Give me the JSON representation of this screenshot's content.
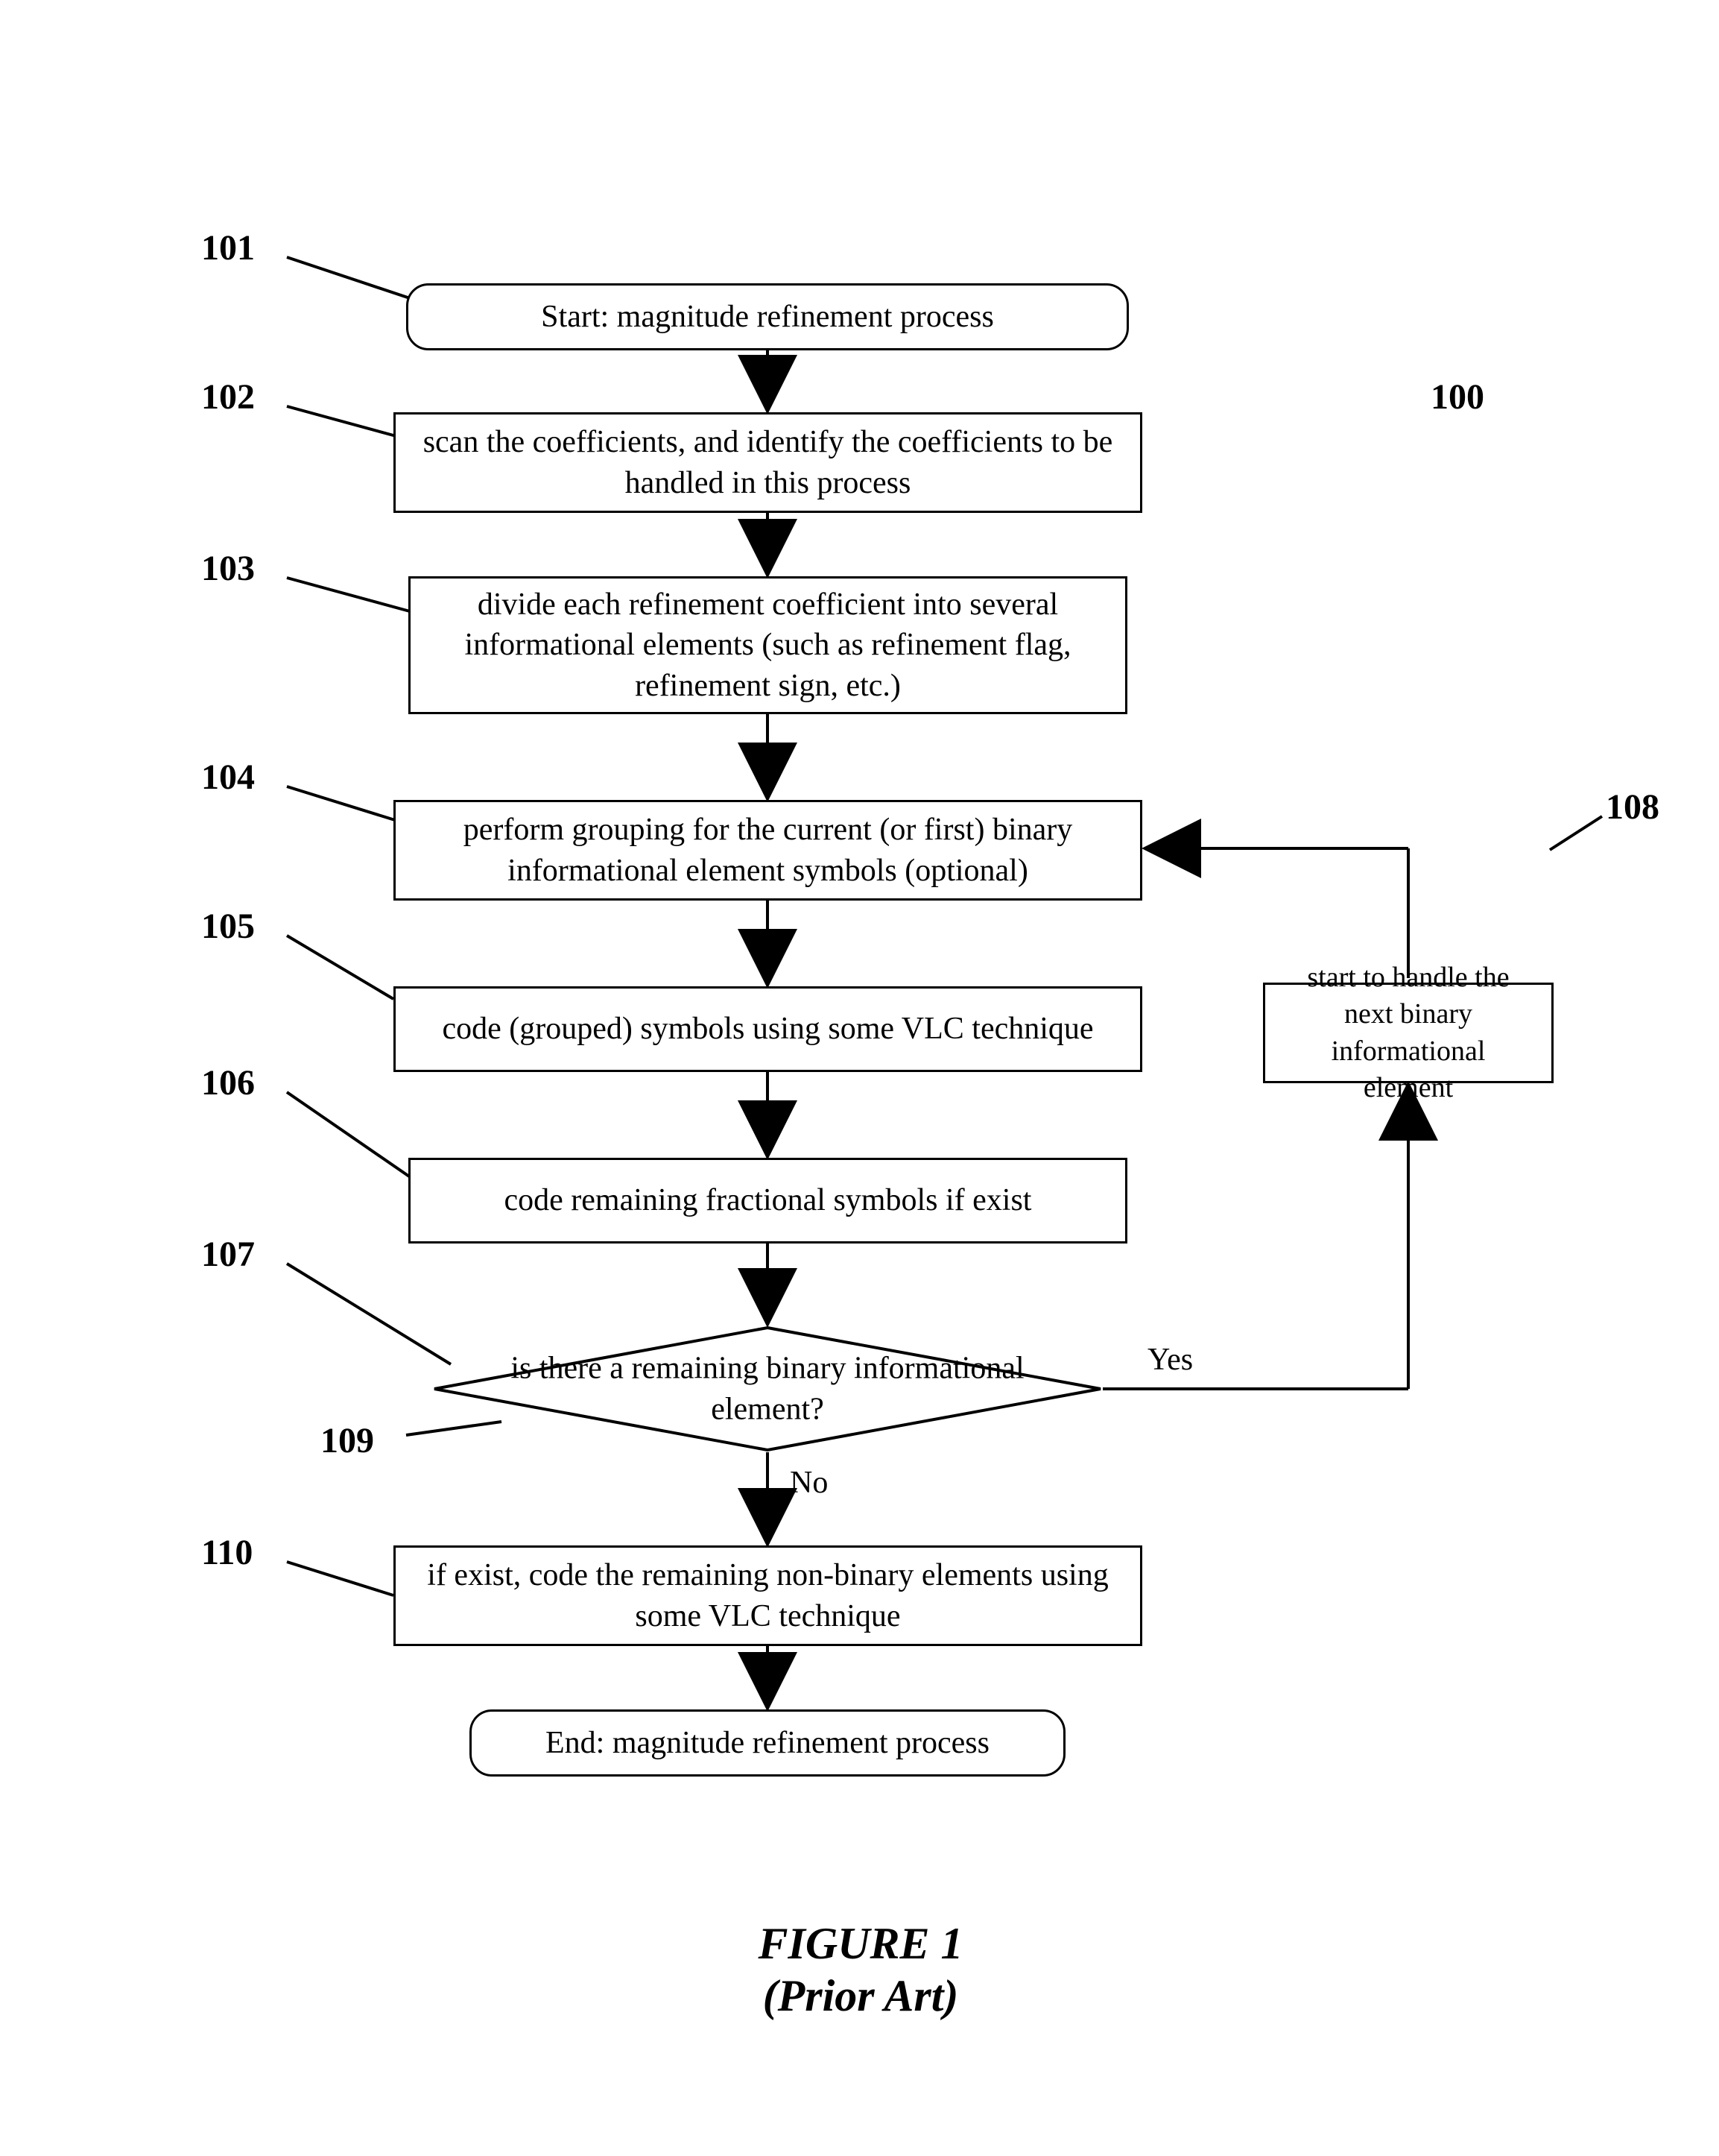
{
  "labels": {
    "n100": "100",
    "n101": "101",
    "n102": "102",
    "n103": "103",
    "n104": "104",
    "n105": "105",
    "n106": "106",
    "n107": "107",
    "n108": "108",
    "n109": "109",
    "n110": "110"
  },
  "boxes": {
    "b101": "Start: magnitude refinement process",
    "b102": "scan the coefficients, and identify the coefficients to be handled in this process",
    "b103": "divide each refinement coefficient into several informational elements (such as refinement flag, refinement sign, etc.)",
    "b104": "perform grouping for the current (or first) binary informational element symbols (optional)",
    "b105": "code (grouped) symbols using some VLC technique",
    "b106": "code remaining fractional symbols if exist",
    "b107": "is there a remaining binary informational element?",
    "b108": "start to handle the next binary informational element",
    "b109": "if exist, code the remaining non-binary elements using some VLC technique",
    "b110": "End: magnitude refinement process"
  },
  "arrows": {
    "yes": "Yes",
    "no": "No"
  },
  "figure": {
    "title": "FIGURE 1",
    "subtitle": "(Prior Art)"
  }
}
